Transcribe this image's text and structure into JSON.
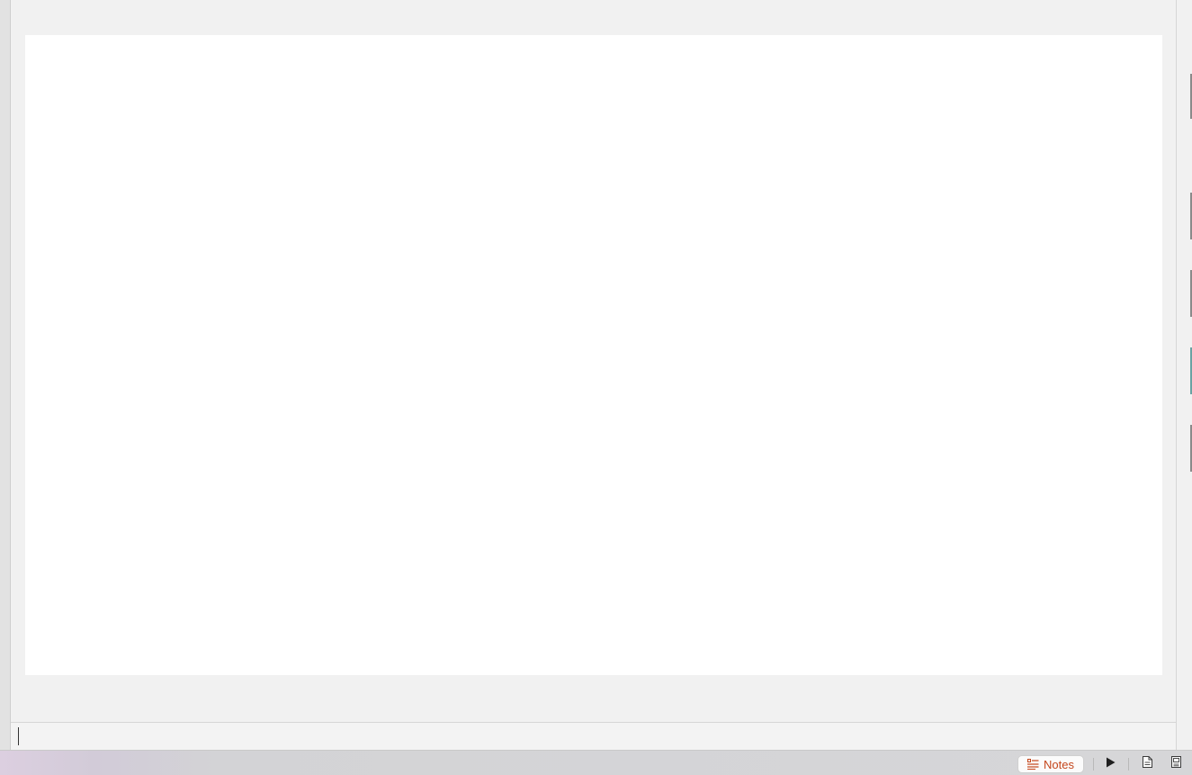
{
  "status_bar": {
    "notes_label": "Notes",
    "accent_color": "#c4461b"
  },
  "icons": {
    "notes": "notes-icon",
    "play": "play-icon",
    "normal_view": "normal-view-icon",
    "reading_view": "reading-view-icon"
  },
  "notes_pane": {
    "text": ""
  }
}
